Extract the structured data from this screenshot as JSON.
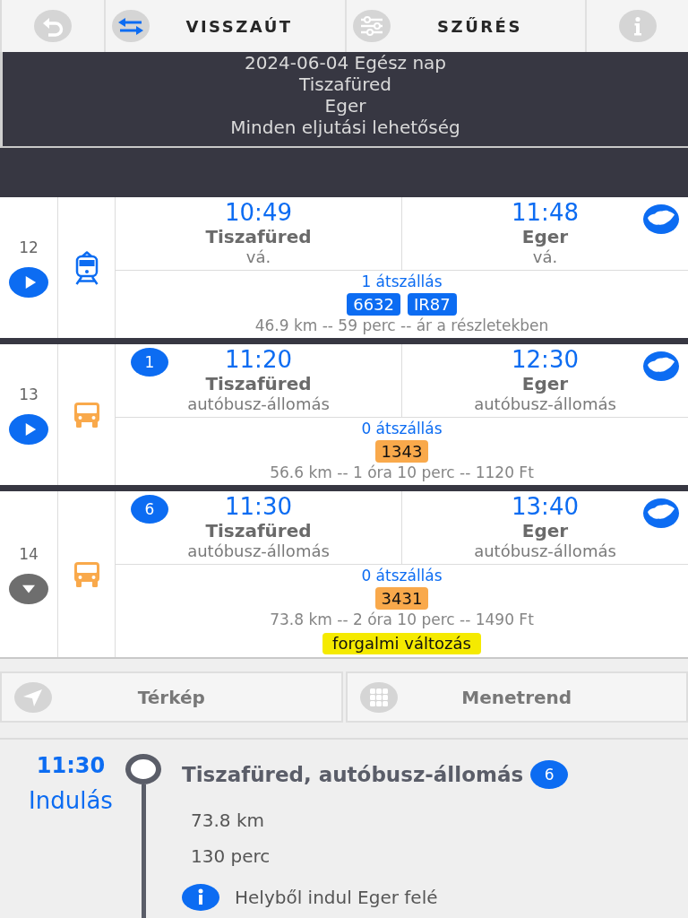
{
  "toolbar": {
    "buttons": [
      {
        "kind": "back"
      },
      {
        "kind": "return",
        "label": "VISSZAÚT"
      },
      {
        "kind": "filter",
        "label": "SZŰRÉS"
      },
      {
        "kind": "info"
      }
    ]
  },
  "search_summary": {
    "date": "2024-06-04 Egész nap",
    "from": "Tiszafüred",
    "to": "Eger",
    "modes": "Minden eljutási lehetőség"
  },
  "results": [
    {
      "index": "12",
      "expanded": false,
      "kind": "train",
      "departure": {
        "time": "10:49",
        "place": "Tiszafüred",
        "station": "vá."
      },
      "arrival": {
        "time": "11:48",
        "place": "Eger",
        "station": "vá."
      },
      "transfers": "1 átszállás",
      "lines": [
        "6632",
        "IR87"
      ],
      "summary": "46.9 km -- 59 perc -- ár a részletekben"
    },
    {
      "index": "13",
      "expanded": false,
      "kind": "bus",
      "departure": {
        "time": "11:20",
        "place": "Tiszafüred",
        "station": "autóbusz-állomás",
        "platform": "1"
      },
      "arrival": {
        "time": "12:30",
        "place": "Eger",
        "station": "autóbusz-állomás"
      },
      "transfers": "0 átszállás",
      "lines": [
        "1343"
      ],
      "summary": "56.6 km -- 1 óra 10 perc -- 1120 Ft"
    },
    {
      "index": "14",
      "expanded": true,
      "kind": "bus",
      "departure": {
        "time": "11:30",
        "place": "Tiszafüred",
        "station": "autóbusz-állomás",
        "platform": "6"
      },
      "arrival": {
        "time": "13:40",
        "place": "Eger",
        "station": "autóbusz-állomás"
      },
      "transfers": "0 átszállás",
      "lines": [
        "3431"
      ],
      "summary": "73.8 km -- 2 óra 10 perc -- 1490 Ft",
      "notice": "forgalmi változás"
    }
  ],
  "detail_tabs": [
    {
      "kind": "map",
      "label": "Térkép"
    },
    {
      "kind": "timetable",
      "label": "Menetrend"
    }
  ],
  "stops": [
    {
      "time": "11:30",
      "event": "Indulás",
      "name": "Tiszafüred, autóbusz-állomás",
      "platform": "6",
      "distance": "73.8 km",
      "duration": "130 perc",
      "note": "Helyből indul Eger felé"
    }
  ]
}
